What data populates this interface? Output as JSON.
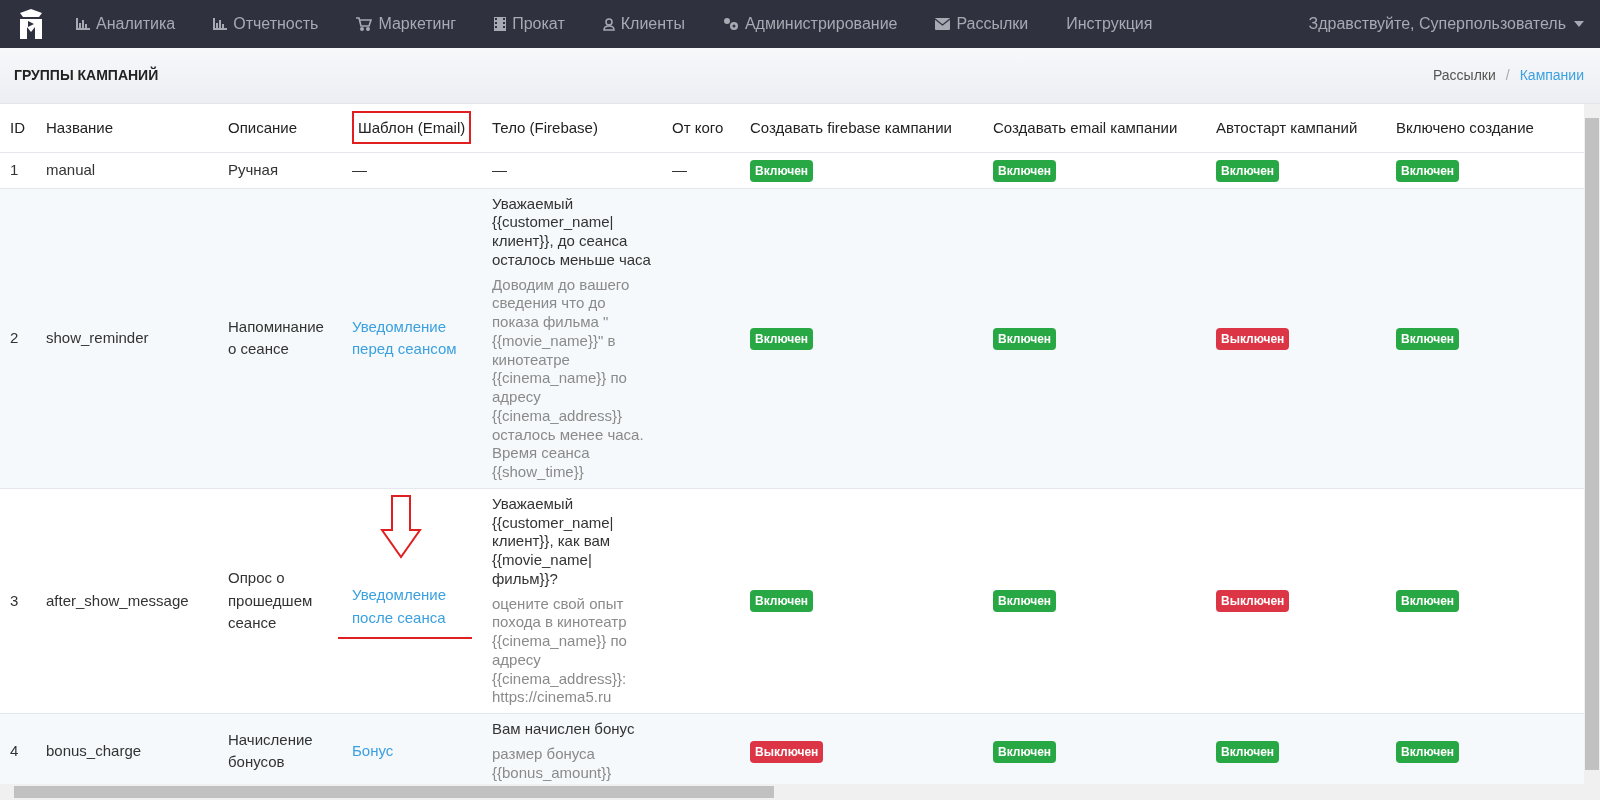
{
  "navbar": {
    "items": [
      {
        "label": "Аналитика"
      },
      {
        "label": "Отчетность"
      },
      {
        "label": "Маркетинг"
      },
      {
        "label": "Прокат"
      },
      {
        "label": "Клиенты"
      },
      {
        "label": "Администрирование"
      },
      {
        "label": "Рассылки"
      },
      {
        "label": "Инструкция"
      }
    ],
    "user_menu": "Здравствуйте, Суперпользователь"
  },
  "page": {
    "title": "ГРУППЫ КАМПАНИЙ",
    "breadcrumb_separator": "/",
    "breadcrumb": [
      {
        "label": "Рассылки",
        "active": false
      },
      {
        "label": "Кампании",
        "active": true
      }
    ]
  },
  "table": {
    "columns": [
      {
        "label": "ID",
        "highlighted": false
      },
      {
        "label": "Название",
        "highlighted": false
      },
      {
        "label": "Описание",
        "highlighted": false
      },
      {
        "label": "Шаблон (Email)",
        "highlighted": true
      },
      {
        "label": "Тело (Firebase)",
        "highlighted": false
      },
      {
        "label": "От кого",
        "highlighted": false
      },
      {
        "label": "Создавать firebase кампании",
        "highlighted": false
      },
      {
        "label": "Создавать email кампании",
        "highlighted": false
      },
      {
        "label": "Автостарт кампаний",
        "highlighted": false
      },
      {
        "label": "Включено создание",
        "highlighted": false
      }
    ],
    "rows": [
      {
        "id": "1",
        "name": "manual",
        "description": "Ручная",
        "template": "—",
        "template_is_link": false,
        "template_marked": false,
        "body_title": "—",
        "body_text": "",
        "sender": "—",
        "flags": [
          {
            "label": "Включен",
            "on": true
          },
          {
            "label": "Включен",
            "on": true
          },
          {
            "label": "Включен",
            "on": true
          },
          {
            "label": "Включен",
            "on": true
          }
        ]
      },
      {
        "id": "2",
        "name": "show_reminder",
        "description": "Напоминание о сеансе",
        "template": "Уведомление перед сеансом",
        "template_is_link": true,
        "template_marked": false,
        "body_title": "Уважаемый {{customer_name| клиент}}, до сеанса осталось меньше часа",
        "body_text": "Доводим до вашего сведения что до показа фильма \"{{movie_name}}\" в кинотеатре {{cinema_name}} по адресу {{cinema_address}} осталось менее часа. Время сеанса {{show_time}}",
        "sender": "",
        "flags": [
          {
            "label": "Включен",
            "on": true
          },
          {
            "label": "Включен",
            "on": true
          },
          {
            "label": "Выключен",
            "on": false
          },
          {
            "label": "Включен",
            "on": true
          }
        ]
      },
      {
        "id": "3",
        "name": "after_show_message",
        "description": "Опрос о прошедшем сеансе",
        "template": "Уведомление после сеанса",
        "template_is_link": true,
        "template_marked": true,
        "body_title": "Уважаемый {{customer_name| клиент}}, как вам {{movie_name| фильм}}?",
        "body_text": "оцените свой опыт похода в кинотеатр {{cinema_name}} по адресу {{cinema_address}}: https://cinema5.ru",
        "sender": "",
        "flags": [
          {
            "label": "Включен",
            "on": true
          },
          {
            "label": "Включен",
            "on": true
          },
          {
            "label": "Выключен",
            "on": false
          },
          {
            "label": "Включен",
            "on": true
          }
        ]
      },
      {
        "id": "4",
        "name": "bonus_charge",
        "description": "Начисление бонусов",
        "template": "Бонус",
        "template_is_link": true,
        "template_marked": false,
        "body_title": "Вам начислен бонус",
        "body_text": "размер бонуса {{bonus_amount}}",
        "sender": "",
        "flags": [
          {
            "label": "Выключен",
            "on": false
          },
          {
            "label": "Включен",
            "on": true
          },
          {
            "label": "Включен",
            "on": true
          },
          {
            "label": "Включен",
            "on": true
          }
        ]
      }
    ]
  }
}
